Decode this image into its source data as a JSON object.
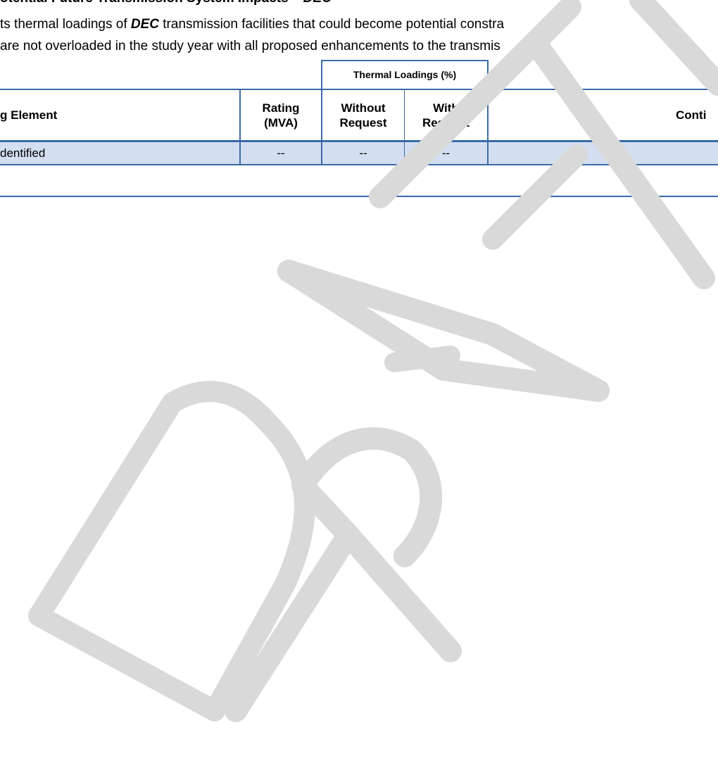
{
  "document": {
    "heading": {
      "prefix": "otential Future Transmission System Impacts – ",
      "highlight": "DEC"
    },
    "paragraph": {
      "line1_before": "ts thermal loadings of ",
      "line1_highlight": "DEC",
      "line1_after": " transmission facilities that could become potential constra",
      "line2": "are not overloaded in the study year with all proposed enhancements to the transmis"
    }
  },
  "table": {
    "group_header": "Thermal Loadings (%)",
    "headers": {
      "element": "g Element",
      "rating_line1": "Rating",
      "rating_line2": "(MVA)",
      "without_line1": "Without",
      "without_line2": "Request",
      "with_line1": "With",
      "with_line2": "Request",
      "contingency": "Conti"
    },
    "rows": [
      {
        "element": "dentified",
        "rating": "--",
        "without": "--",
        "with": "--",
        "contingency": ""
      }
    ]
  },
  "watermark": {
    "text": "DRAFT",
    "color": "#d9d9d9"
  }
}
